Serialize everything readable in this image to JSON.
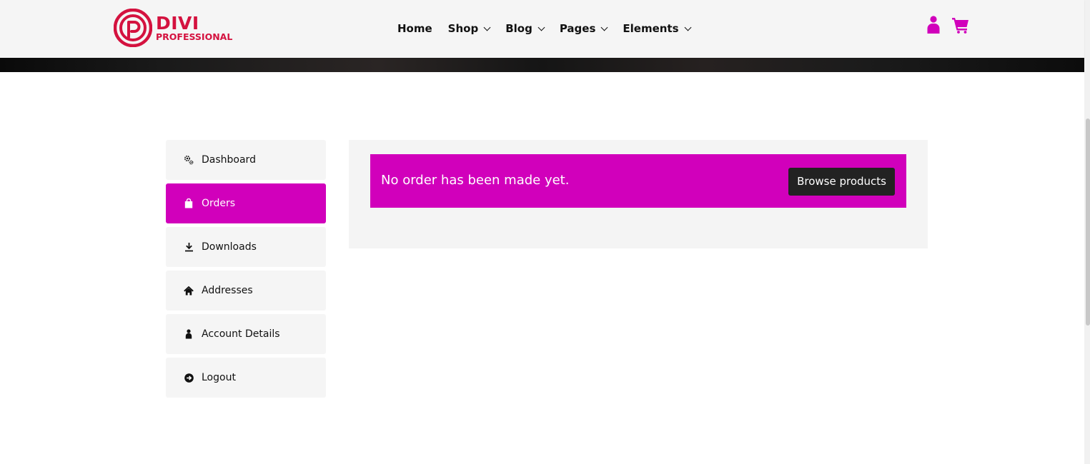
{
  "header": {
    "logo": {
      "title": "DIVI",
      "subtitle": "PROFESSIONAL",
      "color": "#d4123f"
    },
    "nav": [
      {
        "label": "Home",
        "has_dropdown": false
      },
      {
        "label": "Shop",
        "has_dropdown": true
      },
      {
        "label": "Blog",
        "has_dropdown": true
      },
      {
        "label": "Pages",
        "has_dropdown": true
      },
      {
        "label": "Elements",
        "has_dropdown": true
      }
    ],
    "icons": [
      "user-icon",
      "cart-icon"
    ],
    "icon_color": "#d100bb"
  },
  "account_nav": {
    "items": [
      {
        "label": "Dashboard",
        "icon": "gears-icon",
        "active": false
      },
      {
        "label": "Orders",
        "icon": "shopping-bag-icon",
        "active": true
      },
      {
        "label": "Downloads",
        "icon": "download-icon",
        "active": false
      },
      {
        "label": "Addresses",
        "icon": "home-icon",
        "active": false
      },
      {
        "label": "Account Details",
        "icon": "user-icon",
        "active": false
      },
      {
        "label": "Logout",
        "icon": "logout-icon",
        "active": false
      }
    ],
    "active_color": "#d100bb"
  },
  "orders": {
    "notice_text": "No order has been made yet.",
    "browse_button_label": "Browse products"
  },
  "colors": {
    "accent": "#d100bb",
    "brand_red": "#d4123f",
    "button_dark": "#222222",
    "panel_bg": "#f4f4f4"
  }
}
